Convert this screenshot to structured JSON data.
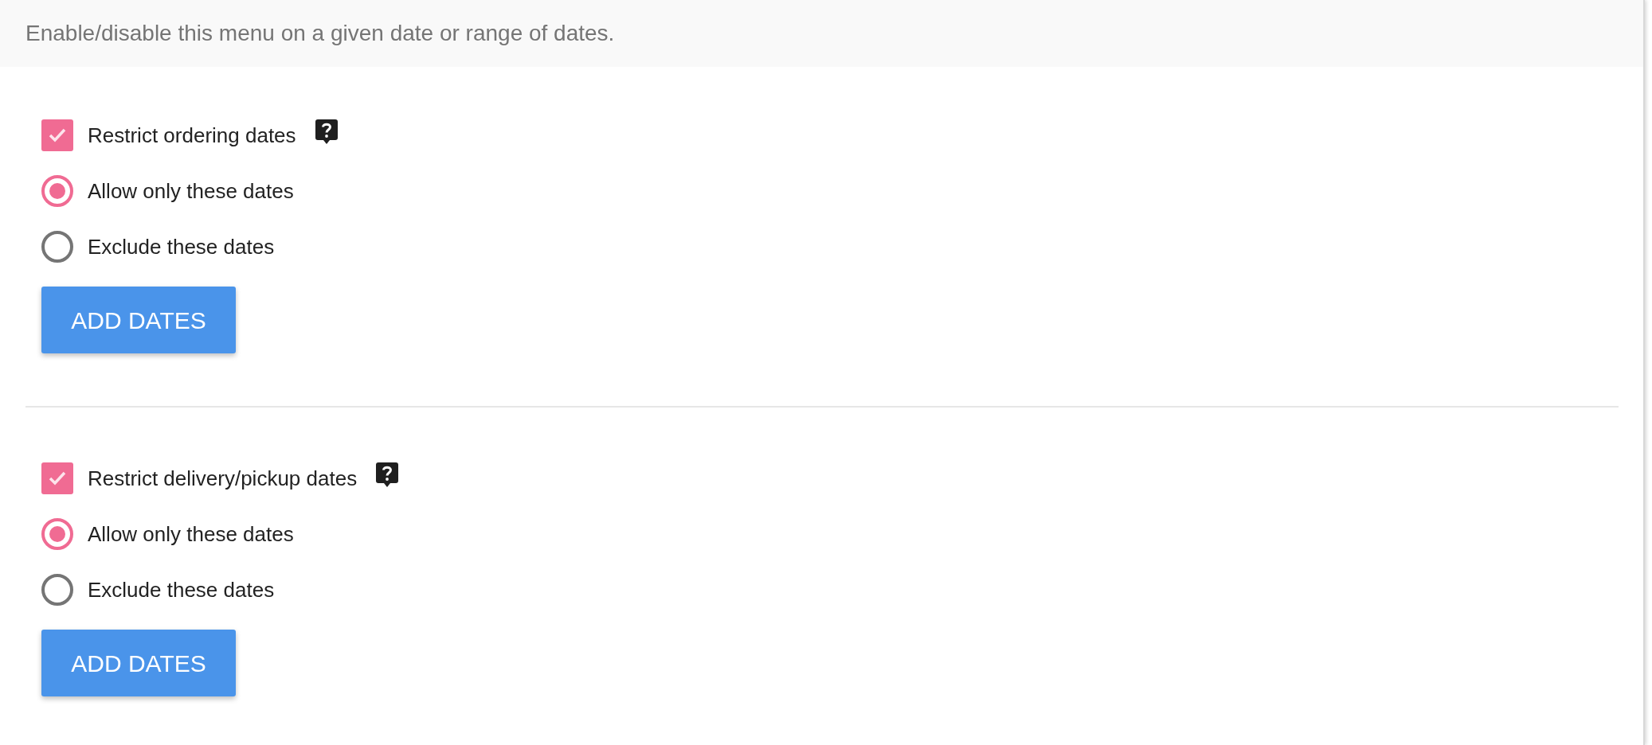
{
  "header": {
    "text": "Enable/disable this menu on a given date or range of dates."
  },
  "sections": [
    {
      "label": "Restrict ordering dates",
      "checked": true,
      "options": [
        {
          "label": "Allow only these dates",
          "selected": true
        },
        {
          "label": "Exclude these dates",
          "selected": false
        }
      ],
      "button": "ADD DATES"
    },
    {
      "label": "Restrict delivery/pickup dates",
      "checked": true,
      "options": [
        {
          "label": "Allow only these dates",
          "selected": true
        },
        {
          "label": "Exclude these dates",
          "selected": false
        }
      ],
      "button": "ADD DATES"
    }
  ]
}
